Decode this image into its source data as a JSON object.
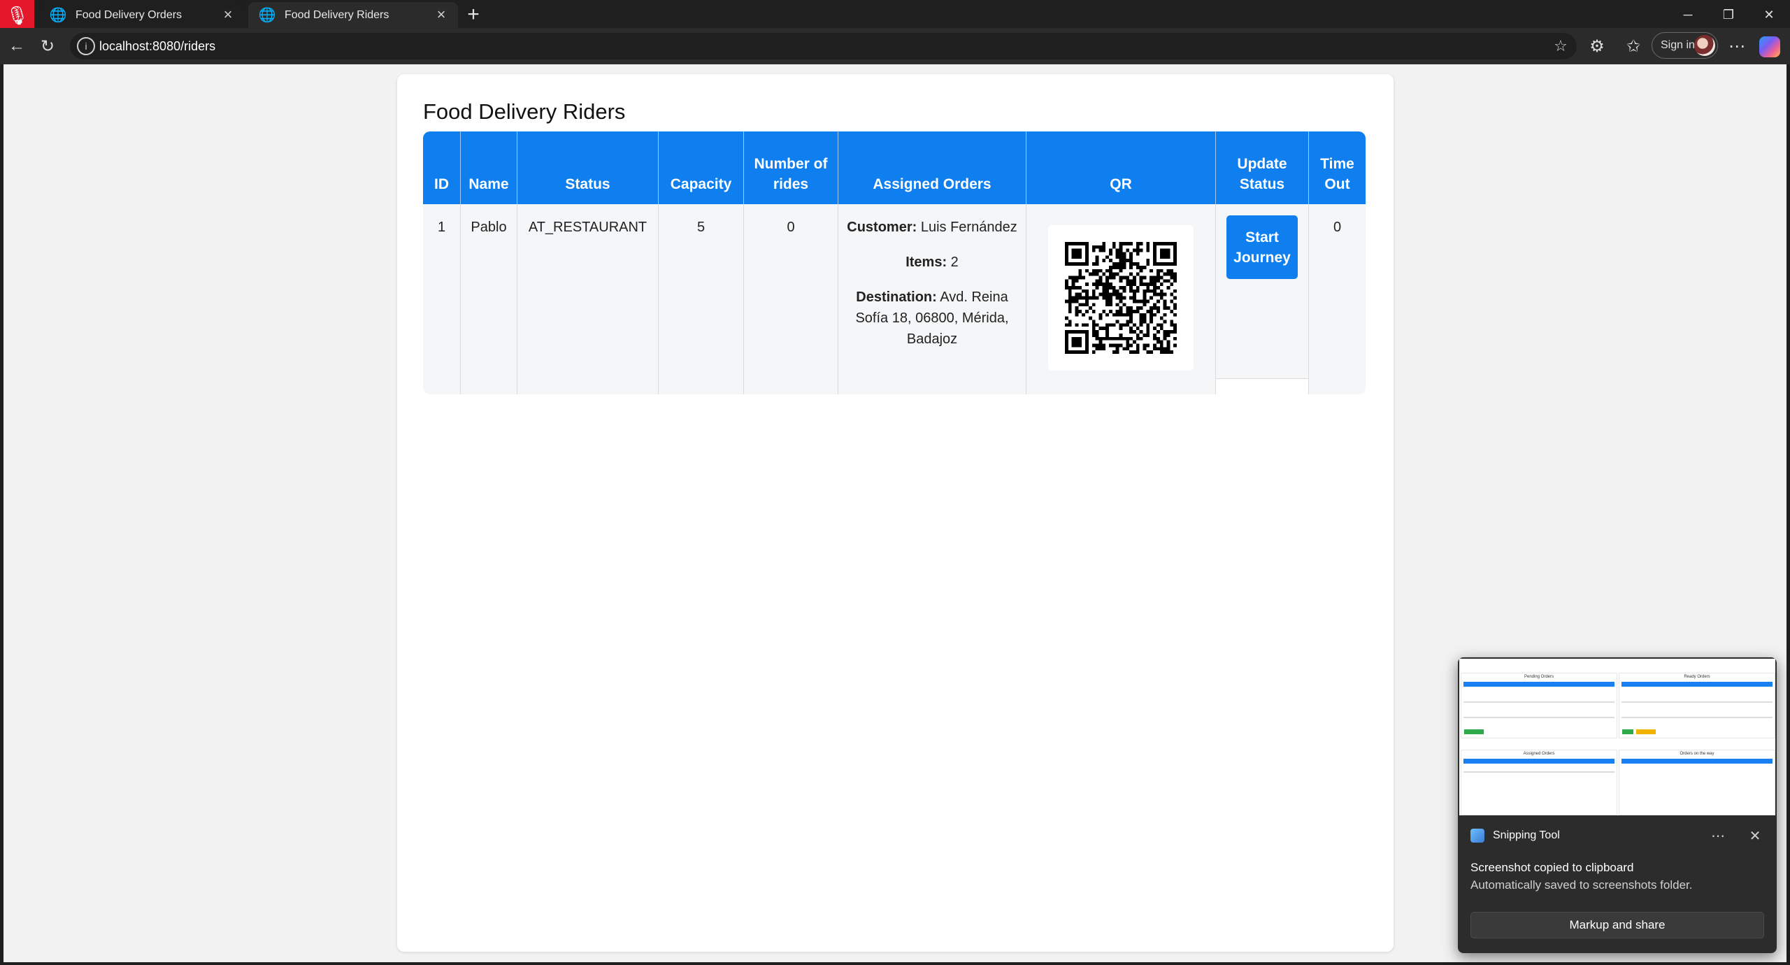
{
  "browser": {
    "tabs": [
      {
        "title": "Food Delivery Orders",
        "active": false
      },
      {
        "title": "Food Delivery Riders",
        "active": true
      }
    ],
    "url": "localhost:8080/riders",
    "sign_in_label": "Sign in",
    "icons": {
      "mic": "microphone-muted-icon",
      "back": "back-arrow-icon",
      "refresh": "refresh-icon",
      "site_info": "info-icon",
      "favorite": "star-icon",
      "extensions": "puzzle-icon",
      "favorites": "favorites-icon",
      "more": "more-icon",
      "copilot": "copilot-icon"
    }
  },
  "page": {
    "title": "Food Delivery Riders",
    "accent_color": "#0f7ff0",
    "table": {
      "headers": [
        "ID",
        "Name",
        "Status",
        "Capacity",
        "Number of rides",
        "Assigned Orders",
        "QR",
        "Update Status",
        "Time Out"
      ],
      "rows": [
        {
          "id": "1",
          "name": "Pablo",
          "status": "AT_RESTAURANT",
          "capacity": "5",
          "rides": "0",
          "order": {
            "customer_label": "Customer:",
            "customer": "Luis Fernández",
            "items_label": "Items:",
            "items": "2",
            "destination_label": "Destination:",
            "destination": "Avd. Reina Sofía 18, 06800, Mérida, Badajoz"
          },
          "action_label": "Start Journey",
          "time_out": "0"
        }
      ]
    }
  },
  "toast": {
    "app_name": "Snipping Tool",
    "heading": "Screenshot copied to clipboard",
    "body": "Automatically saved to screenshots folder.",
    "button_label": "Markup and share",
    "preview": {
      "titles": [
        "Pending Orders",
        "Ready Orders",
        "Assigned Orders",
        "Orders on the way"
      ]
    }
  }
}
